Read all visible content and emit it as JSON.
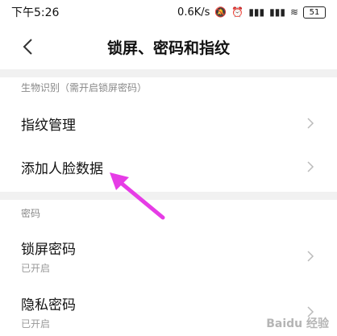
{
  "status_bar": {
    "time": "下午5:26",
    "speed": "0.6K/s",
    "battery": "51"
  },
  "header": {
    "title": "锁屏、密码和指纹"
  },
  "sections": {
    "biometric_label": "生物识别（需开启锁屏密码）",
    "password_label": "密码"
  },
  "rows": {
    "fingerprint": {
      "title": "指纹管理"
    },
    "face": {
      "title": "添加人脸数据"
    },
    "lock_password": {
      "title": "锁屏密码",
      "subtitle": "已开启"
    },
    "privacy_password": {
      "title": "隐私密码",
      "subtitle": "已开启"
    }
  },
  "annotation_color": "#e63ce6",
  "watermark": "Baidu 经验"
}
